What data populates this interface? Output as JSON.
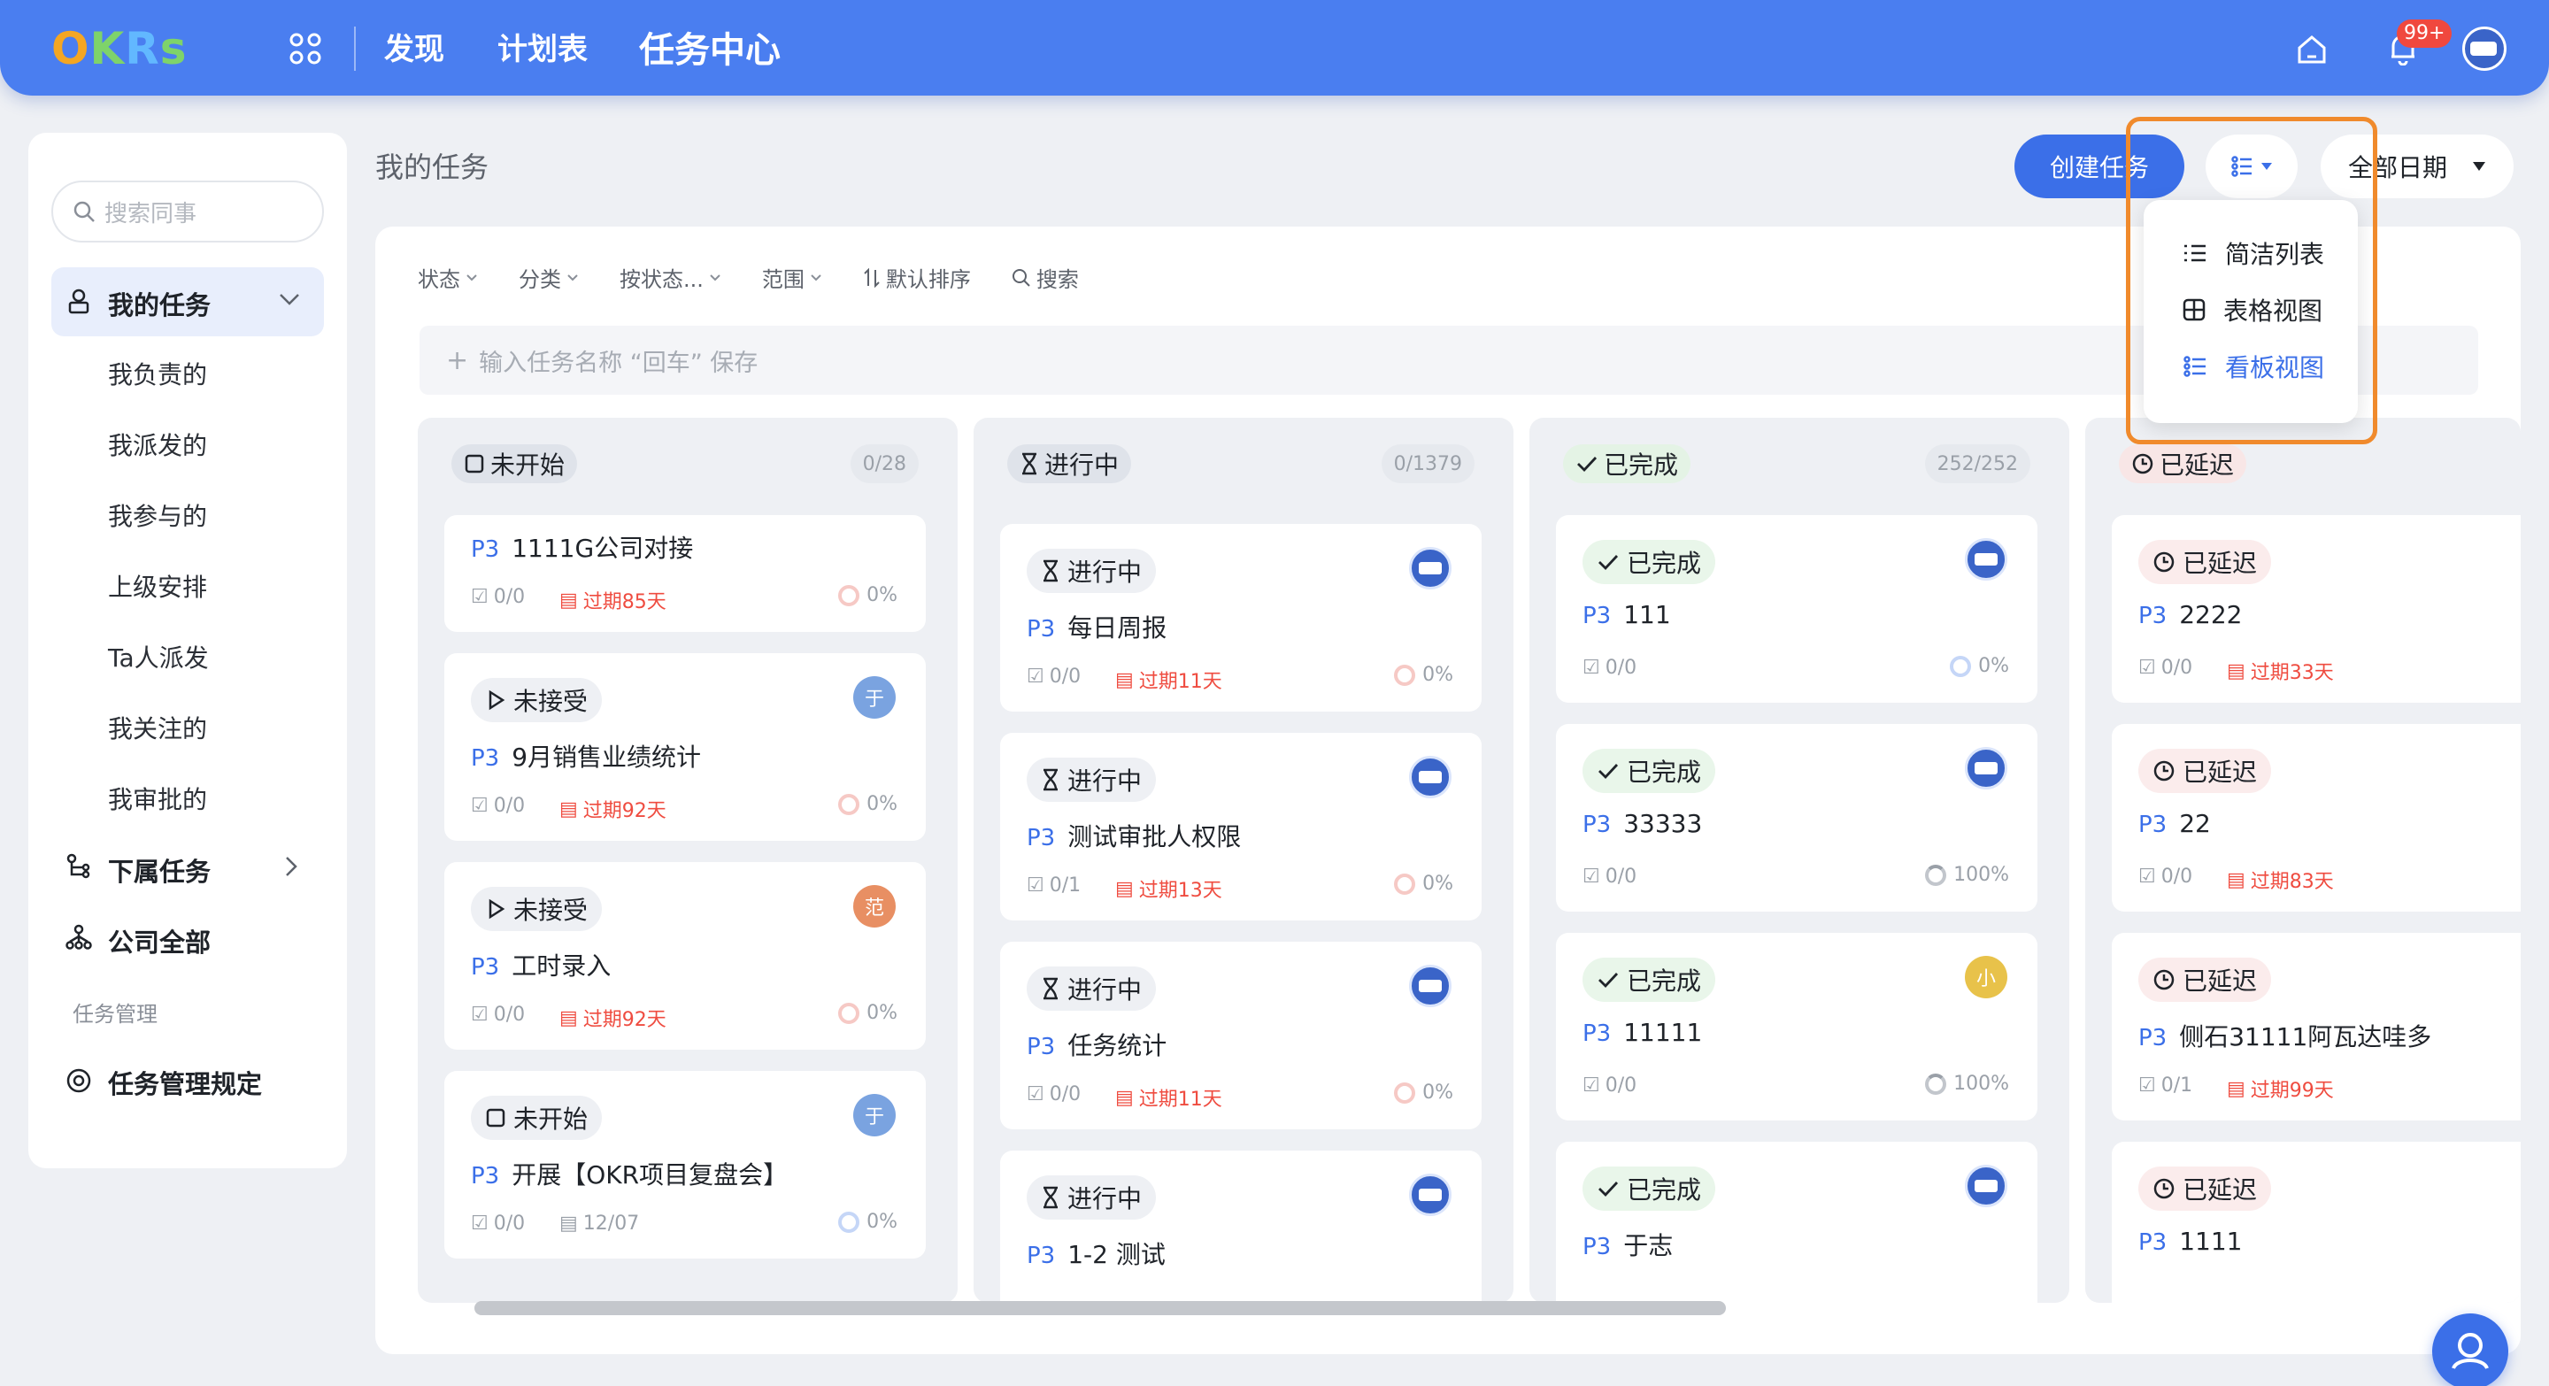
{
  "app": {
    "logo": "OKRs",
    "nav": [
      "发现",
      "计划表",
      "任务中心"
    ],
    "notif_badge": "99+"
  },
  "sidebar": {
    "search_placeholder": "搜索同事",
    "my_tasks": "我的任务",
    "items": [
      "我负责的",
      "我派发的",
      "我参与的",
      "上级安排",
      "Ta人派发",
      "我关注的",
      "我审批的"
    ],
    "sub_tasks": "下属任务",
    "company_all": "公司全部",
    "section_label": "任务管理",
    "rules": "任务管理规定"
  },
  "header": {
    "title": "我的任务",
    "create_btn": "创建任务",
    "date_filter": "全部日期"
  },
  "filters": [
    "状态",
    "分类",
    "按状态...",
    "范围",
    "默认排序",
    "搜索"
  ],
  "quick_add_placeholder": "输入任务名称 “回车” 保存",
  "view_menu": {
    "items": [
      "简洁列表",
      "表格视图",
      "看板视图"
    ],
    "selected": "看板视图"
  },
  "columns": [
    {
      "name": "未开始",
      "count": "0/28",
      "cards": [
        {
          "status": "",
          "priority": "P3",
          "title": "1111G公司对接",
          "subtasks": "0/0",
          "due": "过期85天",
          "progress": "0%"
        },
        {
          "status": "未接受",
          "avatar": "于",
          "priority": "P3",
          "title": "9月销售业绩统计",
          "subtasks": "0/0",
          "due": "过期92天",
          "progress": "0%"
        },
        {
          "status": "未接受",
          "avatar": "范",
          "priority": "P3",
          "title": "工时录入",
          "subtasks": "0/0",
          "due": "过期92天",
          "progress": "0%"
        },
        {
          "status": "未开始",
          "avatar": "于",
          "priority": "P3",
          "title": "开展【OKR项目复盘会】",
          "subtasks": "0/0",
          "due": "12/07",
          "progress": "0%"
        }
      ]
    },
    {
      "name": "进行中",
      "count": "0/1379",
      "cards": [
        {
          "status": "进行中",
          "priority": "P3",
          "title": "每日周报",
          "subtasks": "0/0",
          "due": "过期11天",
          "progress": "0%"
        },
        {
          "status": "进行中",
          "priority": "P3",
          "title": "测试审批人权限",
          "subtasks": "0/1",
          "due": "过期13天",
          "progress": "0%"
        },
        {
          "status": "进行中",
          "priority": "P3",
          "title": "任务统计",
          "subtasks": "0/0",
          "due": "过期11天",
          "progress": "0%"
        },
        {
          "status": "进行中",
          "priority": "P3",
          "title": "1-2 测试"
        }
      ]
    },
    {
      "name": "已完成",
      "count": "252/252",
      "cards": [
        {
          "status": "已完成",
          "priority": "P3",
          "title": "111",
          "subtasks": "0/0",
          "progress": "0%"
        },
        {
          "status": "已完成",
          "priority": "P3",
          "title": "33333",
          "subtasks": "0/0",
          "progress": "100%"
        },
        {
          "status": "已完成",
          "avatar": "小",
          "priority": "P3",
          "title": "11111",
          "subtasks": "0/0",
          "progress": "100%"
        },
        {
          "status": "已完成",
          "priority": "P3",
          "title": "于志"
        }
      ]
    },
    {
      "name": "已延迟",
      "cards": [
        {
          "status": "已延迟",
          "priority": "P3",
          "title": "2222",
          "subtasks": "0/0",
          "due": "过期33天"
        },
        {
          "status": "已延迟",
          "priority": "P3",
          "title": "22",
          "subtasks": "0/0",
          "due": "过期83天"
        },
        {
          "status": "已延迟",
          "priority": "P3",
          "title": "侧石31111阿瓦达哇多",
          "subtasks": "0/1",
          "due": "过期99天"
        },
        {
          "status": "已延迟",
          "priority": "P3",
          "title": "1111"
        }
      ]
    }
  ],
  "colors": {
    "primary": "#3b6fe8",
    "topbar": "#4a7ef0",
    "overdue": "#ef4c40",
    "highlight": "#f08a2c"
  },
  "icons": [
    "apps-icon",
    "home-icon",
    "bell-icon",
    "search-icon",
    "user-icon",
    "chevron-down-icon",
    "chevron-right-icon",
    "list-icon",
    "table-icon",
    "kanban-icon",
    "hourglass-icon",
    "check-icon",
    "clock-icon",
    "play-icon",
    "square-icon"
  ]
}
